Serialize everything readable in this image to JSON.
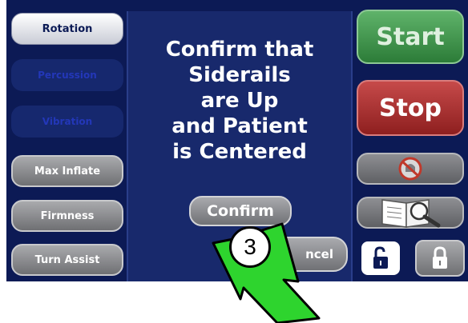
{
  "left_menu": [
    {
      "label": "Rotation",
      "state": "active"
    },
    {
      "label": "Percussion",
      "state": "disabled"
    },
    {
      "label": "Vibration",
      "state": "disabled"
    },
    {
      "label": "Max Inflate",
      "state": "normal"
    },
    {
      "label": "Firmness",
      "state": "normal"
    },
    {
      "label": "Turn Assist",
      "state": "normal"
    }
  ],
  "right_controls": {
    "start_label": "Start",
    "stop_label": "Stop",
    "alarm_icon": "alarm-silence-icon",
    "manual_icon": "manual-magnifier-icon",
    "unlock_icon": "unlock-icon",
    "lock_icon": "lock-icon"
  },
  "dialog": {
    "lines": [
      "Confirm that",
      "Siderails",
      "are Up",
      "and Patient",
      "is Centered"
    ],
    "confirm_label": "Confirm",
    "cancel_label": "ncel"
  },
  "callout": {
    "step_number": "3",
    "arrow_color": "#2ed42e"
  },
  "colors": {
    "panel": "#0c1a55",
    "dialog": "#18296c",
    "start_green": "#2c7c38",
    "stop_red": "#8e1f1f"
  }
}
